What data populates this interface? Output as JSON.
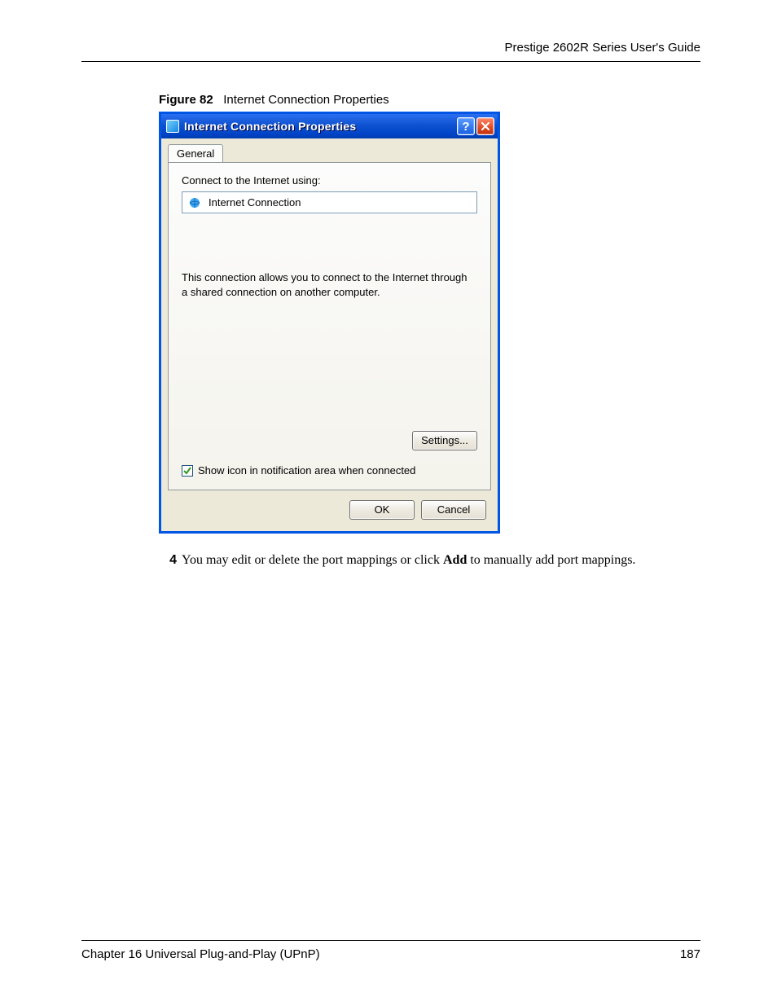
{
  "header": {
    "guide_title": "Prestige 2602R Series User's Guide"
  },
  "figure": {
    "label": "Figure 82",
    "caption": "Internet Connection Properties"
  },
  "dialog": {
    "title": "Internet Connection Properties",
    "tab": "General",
    "connect_label": "Connect to the Internet using:",
    "connection_name": "Internet Connection",
    "description": "This connection allows you to connect to the Internet through a shared connection on another computer.",
    "settings_button": "Settings...",
    "checkbox_label": "Show icon in notification area when connected",
    "checkbox_checked": true,
    "ok_button": "OK",
    "cancel_button": "Cancel"
  },
  "step": {
    "number": "4",
    "text_before": "You may edit or delete the port mappings or click ",
    "bold": "Add",
    "text_after": " to manually add port mappings."
  },
  "footer": {
    "chapter": "Chapter 16 Universal Plug-and-Play (UPnP)",
    "page": "187"
  }
}
